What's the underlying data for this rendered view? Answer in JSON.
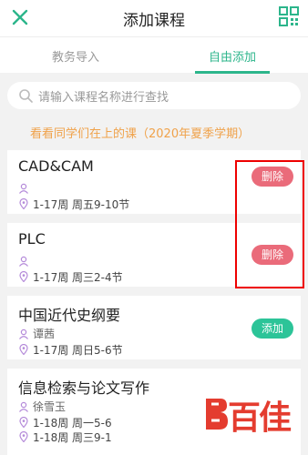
{
  "header": {
    "title": "添加课程",
    "close_icon": "close-icon",
    "qr_icon": "qr-code-icon"
  },
  "tabs": [
    {
      "label": "教务导入"
    },
    {
      "label": "自由添加"
    }
  ],
  "search": {
    "placeholder": "请输入课程名称进行查找"
  },
  "banner": "看看同学们在上的课（2020年夏季学期）",
  "courses": [
    {
      "name": "CAD&CAM",
      "teacher": "",
      "time": "1-17周 周五9-10节",
      "action": "删除"
    },
    {
      "name": "PLC",
      "teacher": "",
      "time": "1-17周 周三2-4节",
      "action": "删除"
    },
    {
      "name": "中国近代史纲要",
      "teacher": "谭茜",
      "time": "1-17周 周日5-6节",
      "action": "添加"
    },
    {
      "name": "信息检索与论文写作",
      "teacher": "徐雪玉",
      "time": "1-18周 周一5-6",
      "time2": "1-18周 周三9-1"
    }
  ],
  "watermark": "百佳",
  "colors": {
    "accent": "#2cb58b",
    "delete": "#ea6b7a",
    "add": "#2cc498",
    "banner": "#f0a24a",
    "highlight": "#e00000"
  }
}
